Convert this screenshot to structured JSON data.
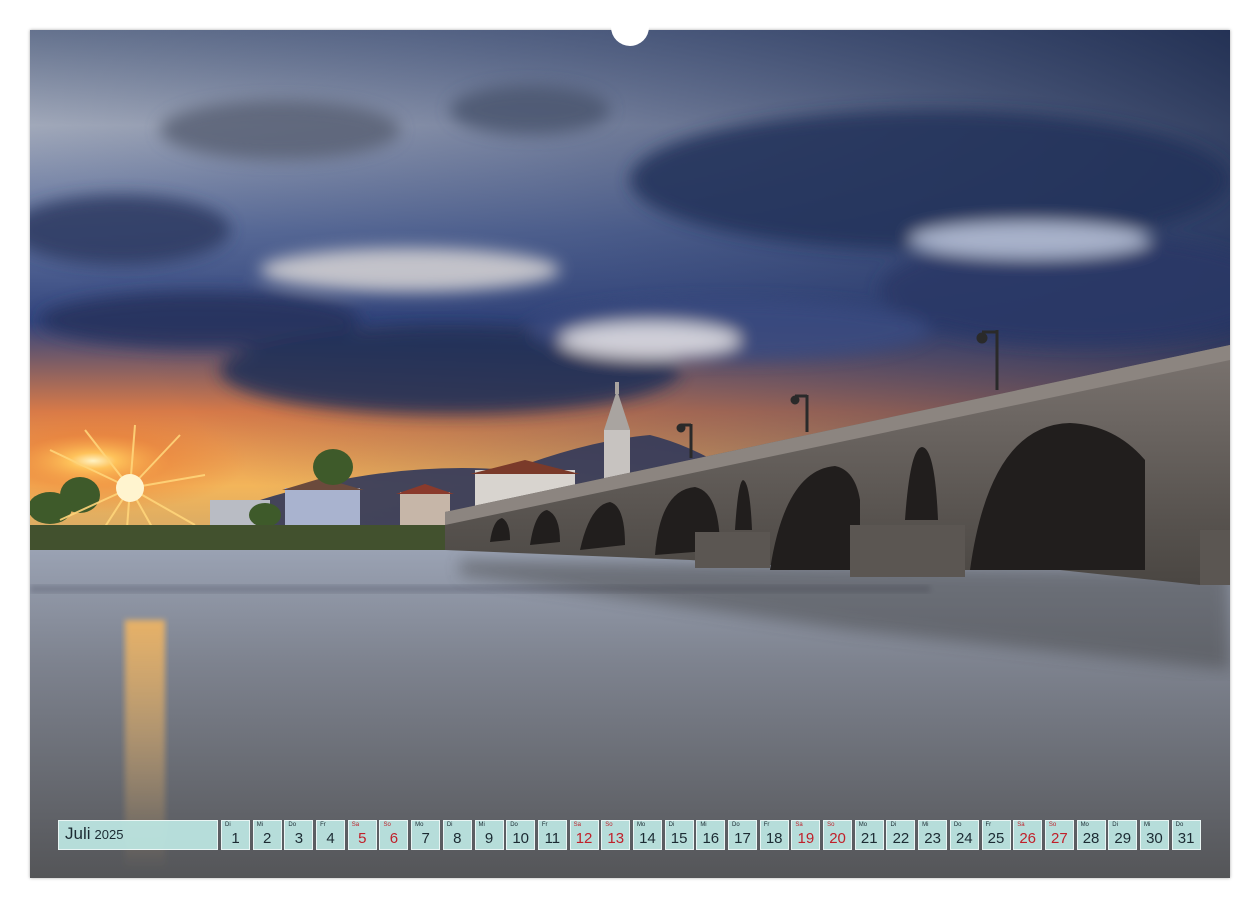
{
  "calendar": {
    "month": "Juli",
    "year": "2025",
    "days": [
      {
        "weekday": "Di",
        "day": "1",
        "weekend": false
      },
      {
        "weekday": "Mi",
        "day": "2",
        "weekend": false
      },
      {
        "weekday": "Do",
        "day": "3",
        "weekend": false
      },
      {
        "weekday": "Fr",
        "day": "4",
        "weekend": false
      },
      {
        "weekday": "Sa",
        "day": "5",
        "weekend": true
      },
      {
        "weekday": "So",
        "day": "6",
        "weekend": true
      },
      {
        "weekday": "Mo",
        "day": "7",
        "weekend": false
      },
      {
        "weekday": "Di",
        "day": "8",
        "weekend": false
      },
      {
        "weekday": "Mi",
        "day": "9",
        "weekend": false
      },
      {
        "weekday": "Do",
        "day": "10",
        "weekend": false
      },
      {
        "weekday": "Fr",
        "day": "11",
        "weekend": false
      },
      {
        "weekday": "Sa",
        "day": "12",
        "weekend": true
      },
      {
        "weekday": "So",
        "day": "13",
        "weekend": true
      },
      {
        "weekday": "Mo",
        "day": "14",
        "weekend": false
      },
      {
        "weekday": "Di",
        "day": "15",
        "weekend": false
      },
      {
        "weekday": "Mi",
        "day": "16",
        "weekend": false
      },
      {
        "weekday": "Do",
        "day": "17",
        "weekend": false
      },
      {
        "weekday": "Fr",
        "day": "18",
        "weekend": false
      },
      {
        "weekday": "Sa",
        "day": "19",
        "weekend": true
      },
      {
        "weekday": "So",
        "day": "20",
        "weekend": true
      },
      {
        "weekday": "Mo",
        "day": "21",
        "weekend": false
      },
      {
        "weekday": "Di",
        "day": "22",
        "weekend": false
      },
      {
        "weekday": "Mi",
        "day": "23",
        "weekend": false
      },
      {
        "weekday": "Do",
        "day": "24",
        "weekend": false
      },
      {
        "weekday": "Fr",
        "day": "25",
        "weekend": false
      },
      {
        "weekday": "Sa",
        "day": "26",
        "weekend": true
      },
      {
        "weekday": "So",
        "day": "27",
        "weekend": true
      },
      {
        "weekday": "Mo",
        "day": "28",
        "weekend": false
      },
      {
        "weekday": "Di",
        "day": "29",
        "weekend": false
      },
      {
        "weekday": "Mi",
        "day": "30",
        "weekend": false
      },
      {
        "weekday": "Do",
        "day": "31",
        "weekend": false
      }
    ]
  },
  "colors": {
    "cell_background": "#bee8e4",
    "weekend_text": "#c0202a",
    "weekday_text": "#1c2b33",
    "sky_dark": "#1c2a4e",
    "sunset": "#f3a23a",
    "water": "#8a8f9a"
  },
  "photo": {
    "icon": "landscape-photo"
  }
}
